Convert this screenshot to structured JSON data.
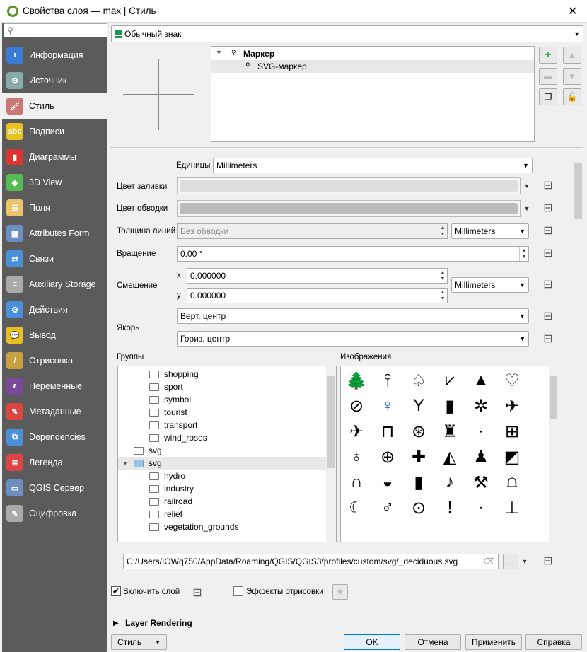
{
  "window": {
    "title": "Свойства слоя — max | Стиль",
    "close": "✕"
  },
  "search": {
    "placeholder": ""
  },
  "sidebar": {
    "items": [
      {
        "label": "Информация",
        "icon": "info-icon",
        "color": "#3a7bd5",
        "glyph": "i"
      },
      {
        "label": "Источник",
        "icon": "source-tools-icon",
        "color": "#8aa",
        "glyph": "⚙"
      },
      {
        "label": "Стиль",
        "icon": "style-brush-icon",
        "color": "#c77",
        "glyph": "🖌"
      },
      {
        "label": "Подписи",
        "icon": "labels-abc-icon",
        "color": "#e8c020",
        "glyph": "abc"
      },
      {
        "label": "Диаграммы",
        "icon": "diagrams-icon",
        "color": "#d33",
        "glyph": "▮"
      },
      {
        "label": "3D View",
        "icon": "3d-cube-icon",
        "color": "#5b5",
        "glyph": "◆"
      },
      {
        "label": "Поля",
        "icon": "fields-icon",
        "color": "#e9c46a",
        "glyph": "☰"
      },
      {
        "label": "Attributes Form",
        "icon": "attributes-form-icon",
        "color": "#6a8fc0",
        "glyph": "▦"
      },
      {
        "label": "Связи",
        "icon": "joins-icon",
        "color": "#4a90d9",
        "glyph": "⇄"
      },
      {
        "label": "Auxiliary Storage",
        "icon": "database-icon",
        "color": "#aaa",
        "glyph": "≡"
      },
      {
        "label": "Действия",
        "icon": "actions-gear-icon",
        "color": "#4a90d9",
        "glyph": "⚙"
      },
      {
        "label": "Вывод",
        "icon": "tooltip-icon",
        "color": "#e8c020",
        "glyph": "💬"
      },
      {
        "label": "Отрисовка",
        "icon": "rendering-brush-icon",
        "color": "#c9a040",
        "glyph": "/"
      },
      {
        "label": "Переменные",
        "icon": "variables-icon",
        "color": "#7a4a9a",
        "glyph": "ε"
      },
      {
        "label": "Метаданные",
        "icon": "metadata-icon",
        "color": "#d44",
        "glyph": "✎"
      },
      {
        "label": "Dependencies",
        "icon": "dependencies-icon",
        "color": "#4a90d9",
        "glyph": "⧉"
      },
      {
        "label": "Легенда",
        "icon": "legend-icon",
        "color": "#d44",
        "glyph": "≣"
      },
      {
        "label": "QGIS Сервер",
        "icon": "server-icon",
        "color": "#6a8fc0",
        "glyph": "▭"
      },
      {
        "label": "Оцифровка",
        "icon": "digitizing-icon",
        "color": "#aaa",
        "glyph": "✎"
      }
    ],
    "active": 2
  },
  "renderer": {
    "value": "Обычный знак"
  },
  "symbol_tree": {
    "root": "Маркер",
    "child": "SVG-маркер"
  },
  "form": {
    "units_label": "Единицы",
    "units_value": "Millimeters",
    "fill_label": "Цвет заливки",
    "stroke_label": "Цвет обводки",
    "width_label": "Толщина линий",
    "width_value": "Без обводки",
    "width_units": "Millimeters",
    "rotation_label": "Вращение",
    "rotation_value": "0.00 °",
    "offset_label": "Смещение",
    "x_label": "x",
    "x_value": "0.000000",
    "y_label": "y",
    "y_value": "0.000000",
    "offset_units": "Millimeters",
    "anchor_label": "Якорь",
    "anchor_v": "Верт. центр",
    "anchor_h": "Гориз. центр"
  },
  "groups": {
    "label": "Группы",
    "items": [
      {
        "label": "shopping",
        "level": 2
      },
      {
        "label": "sport",
        "level": 2
      },
      {
        "label": "symbol",
        "level": 2
      },
      {
        "label": "tourist",
        "level": 2
      },
      {
        "label": "transport",
        "level": 2
      },
      {
        "label": "wind_roses",
        "level": 2
      },
      {
        "label": "svg",
        "level": 1
      },
      {
        "label": "svg",
        "level": 1,
        "expanded": true,
        "selected": true
      },
      {
        "label": "hydro",
        "level": 2
      },
      {
        "label": "industry",
        "level": 2
      },
      {
        "label": "railroad",
        "level": 2
      },
      {
        "label": "relief",
        "level": 2
      },
      {
        "label": "vegetation_grounds",
        "level": 2
      }
    ]
  },
  "images": {
    "label": "Изображения",
    "glyphs": [
      "🌲",
      "⫯",
      "♤",
      "⩗",
      "▲",
      "♡",
      "⊘",
      "♀",
      "Y",
      "▮",
      "✲",
      "✈",
      "✈",
      "⊓",
      "⊛",
      "♜",
      "·",
      "⊞",
      "♁",
      "⊕",
      "✚",
      "◭",
      "♟",
      "◩",
      "∩",
      "◒",
      "▮",
      "♪",
      "⚒",
      "⩍",
      "☾",
      "♂",
      "⊙",
      "!",
      "·",
      "⊥"
    ]
  },
  "svg_path": {
    "value": "C:/Users/IOWq750/AppData/Roaming/QGIS/QGIS3/profiles/custom/svg/_deciduous.svg",
    "browse": "..."
  },
  "enable_layer": {
    "label": "Включить слой",
    "checked": true
  },
  "effects": {
    "label": "Эффекты отрисовки",
    "checked": false
  },
  "layer_rendering": {
    "label": "Layer Rendering"
  },
  "footer": {
    "style": "Стиль",
    "ok": "OK",
    "cancel": "Отмена",
    "apply": "Применить",
    "help": "Справка"
  }
}
